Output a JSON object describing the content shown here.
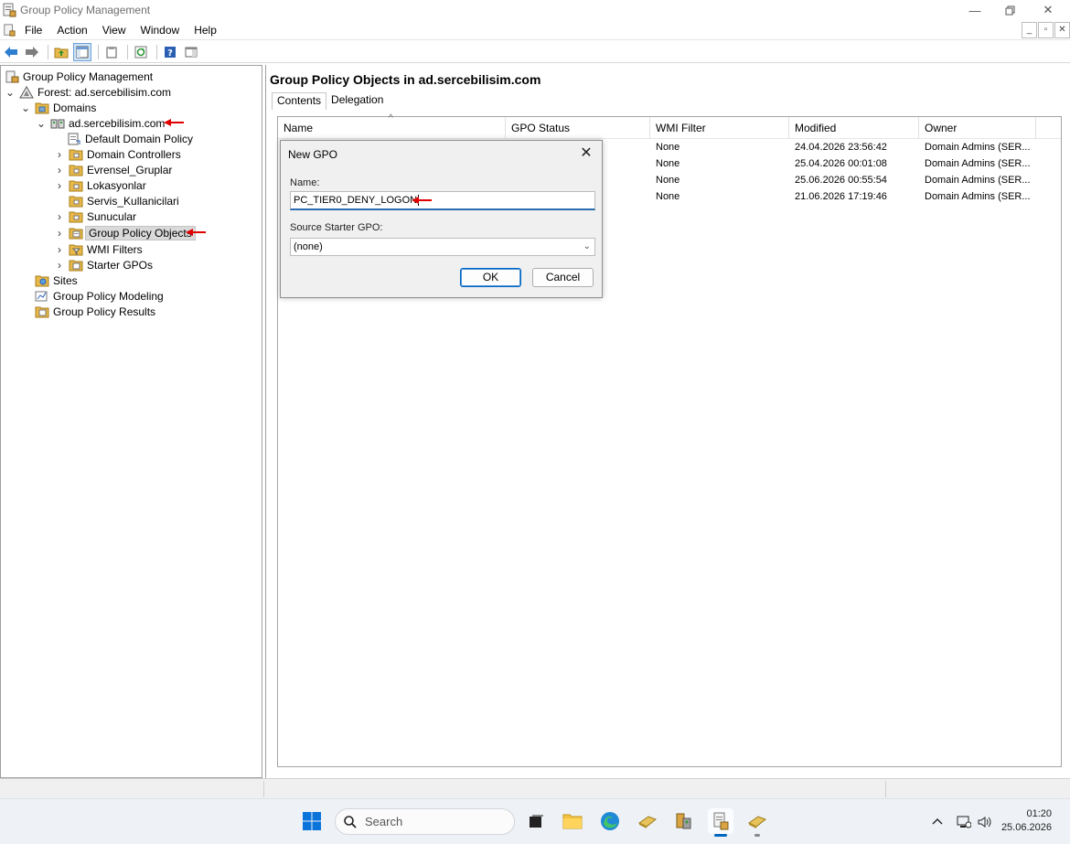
{
  "window": {
    "title": "Group Policy Management"
  },
  "menu": [
    "File",
    "Action",
    "View",
    "Window",
    "Help"
  ],
  "tree": {
    "root": "Group Policy Management",
    "forest": "Forest: ad.sercebilisim.com",
    "domains": "Domains",
    "domain": "ad.sercebilisim.com",
    "children": [
      "Default Domain Policy",
      "Domain Controllers",
      "Evrensel_Gruplar",
      "Lokasyonlar",
      "Servis_Kullanicilari",
      "Sunucular",
      "Group Policy Objects",
      "WMI Filters",
      "Starter GPOs"
    ],
    "sites": "Sites",
    "modeling": "Group Policy Modeling",
    "results": "Group Policy Results"
  },
  "details": {
    "title": "Group Policy Objects in ad.sercebilisim.com",
    "tabs": [
      "Contents",
      "Delegation"
    ],
    "columns": [
      "Name",
      "GPO Status",
      "WMI Filter",
      "Modified",
      "Owner"
    ],
    "rows": [
      {
        "wmi": "None",
        "modified": "24.04.2026 23:56:42",
        "owner": "Domain Admins (SER..."
      },
      {
        "wmi": "None",
        "modified": "25.04.2026 00:01:08",
        "owner": "Domain Admins (SER..."
      },
      {
        "wmi": "None",
        "modified": "25.06.2026 00:55:54",
        "owner": "Domain Admins (SER..."
      },
      {
        "wmi": "None",
        "modified": "21.06.2026 17:19:46",
        "owner": "Domain Admins (SER..."
      }
    ]
  },
  "dialog": {
    "title": "New GPO",
    "name_label": "Name:",
    "name_value": "PC_TIER0_DENY_LOGON",
    "source_label": "Source Starter GPO:",
    "source_value": "(none)",
    "ok": "OK",
    "cancel": "Cancel"
  },
  "taskbar": {
    "search_placeholder": "Search",
    "time": "01:20",
    "date": "25.06.2026"
  },
  "colors": {
    "accent": "#0067c0",
    "annotation_arrow": "#e00000",
    "folder": "#e8b948"
  }
}
